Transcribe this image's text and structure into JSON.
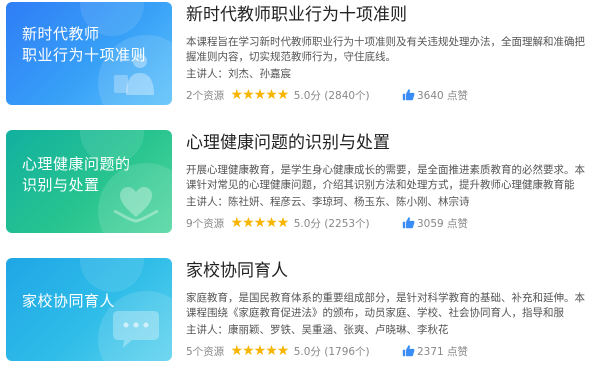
{
  "courses": [
    {
      "thumb_lines": [
        "新时代教师",
        "职业行为十项准则"
      ],
      "title": "新时代教师职业行为十项准则",
      "desc": "本课程旨在学习新时代教师职业行为十项准则及有关违规处理办法，全面理解和准确把握准则内容，切实规范教师行为，守住底线。",
      "lecturer": "主讲人：刘杰、孙嘉宸",
      "resources": "2个资源",
      "stars": 5,
      "score": "5.0分",
      "ratings": "(2840个)",
      "likes": "3640 点赞",
      "accent": "#2f7df6"
    },
    {
      "thumb_lines": [
        "心理健康问题的",
        "识别与处置"
      ],
      "title": "心理健康问题的识别与处置",
      "desc": "开展心理健康教育，是学生身心健康成长的需要，是全面推进素质教育的必然要求。本课针对常见的心理健康问题，介绍其识别方法和处理方式，提升教师心理健康教育能力。",
      "lecturer": "主讲人：陈社妍、程彦云、李琼珂、杨玉东、陈小刚、林宗诗",
      "resources": "9个资源",
      "stars": 5,
      "score": "5.0分",
      "ratings": "(2253个)",
      "likes": "3059 点赞",
      "accent": "#12b0a0"
    },
    {
      "thumb_lines": [
        "家校协同育人"
      ],
      "title": "家校协同育人",
      "desc": "家庭教育，是国民教育体系的重要组成部分，是针对科学教育的基础、补充和延伸。本课程围绕《家庭教育促进法》的颁布，动员家庭、学校、社会协同育人，指导和服务……",
      "lecturer": "主讲人：康丽颖、罗铁、吴重涵、张爽、卢晓琳、李秋花",
      "resources": "5个资源",
      "stars": 5,
      "score": "5.0分",
      "ratings": "(1796个)",
      "likes": "2371 点赞",
      "accent": "#1fa6e6"
    }
  ],
  "colors": {
    "star": "#f7b500",
    "like_icon": "#3a8df7",
    "title": "#222222"
  }
}
